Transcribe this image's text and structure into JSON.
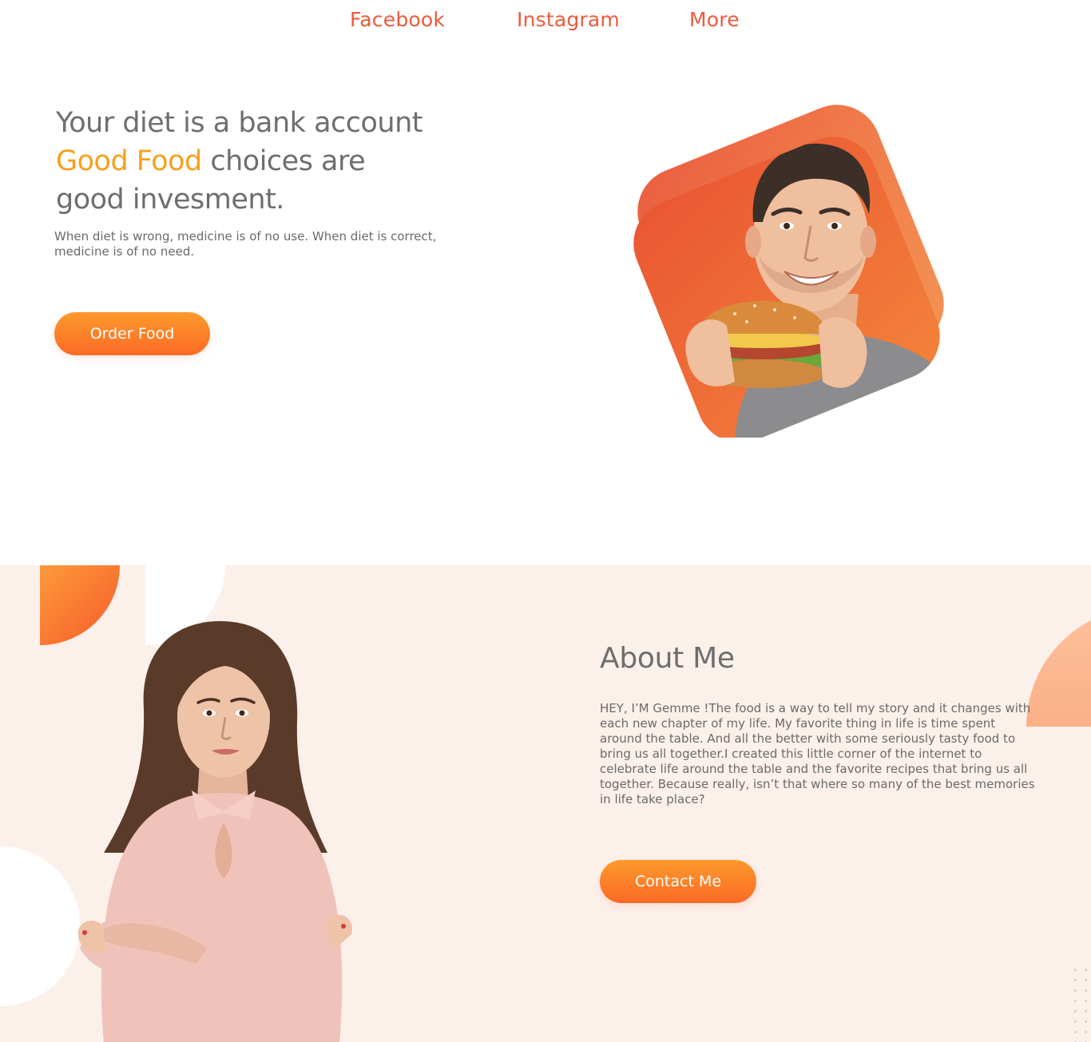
{
  "nav": {
    "items": [
      "Facebook",
      "Instagram",
      "More"
    ]
  },
  "hero": {
    "title_line1": "Your diet is a bank account",
    "title_accent": "Good Food",
    "title_line2_rest": " choices are",
    "title_line3": "good invesment.",
    "subtitle": "When diet is wrong, medicine is of no use. When diet is correct, medicine is of no need.",
    "button": "Order Food"
  },
  "about": {
    "title": "About Me",
    "body": "HEY, I’M Gemme !The food is a way to tell my story and it changes with each new chapter of my life. My favorite thing in life is time spent around the table. And all the better with some seriously tasty food to bring us all together.I created this little corner of the internet to celebrate life around the table and the favorite recipes that bring us all together. Because really, isn’t that where so many of the best memories in life take place?",
    "button": "Contact Me"
  },
  "colors": {
    "accent_orange": "#f5a11c",
    "nav_link": "#ef5a3c",
    "button_gradient_top": "#fd9a2c",
    "button_gradient_bottom": "#fb6a26",
    "about_background": "#fcf0eb",
    "text_gray": "#6e6e6e"
  }
}
